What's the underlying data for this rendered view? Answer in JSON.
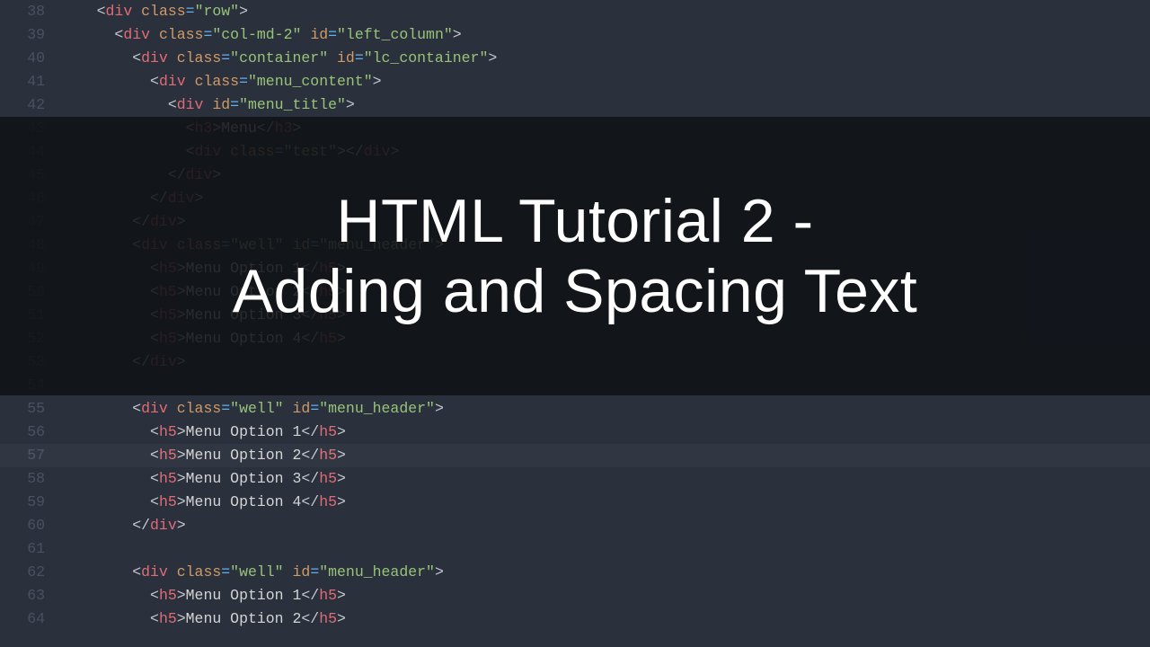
{
  "overlay": {
    "line1": "HTML Tutorial 2 -",
    "line2": "Adding and Spacing Text"
  },
  "highlight_line": 57,
  "first_line_number": 38,
  "code_lines": [
    {
      "n": 38,
      "ind": 2,
      "t": [
        [
          "p",
          "<"
        ],
        [
          "tg",
          "div"
        ],
        [
          "p",
          " "
        ],
        [
          "an",
          "class"
        ],
        [
          "op",
          "="
        ],
        [
          "st",
          "\"row\""
        ],
        [
          "p",
          ">"
        ]
      ]
    },
    {
      "n": 39,
      "ind": 3,
      "t": [
        [
          "p",
          "<"
        ],
        [
          "tg",
          "div"
        ],
        [
          "p",
          " "
        ],
        [
          "an",
          "class"
        ],
        [
          "op",
          "="
        ],
        [
          "st",
          "\"col-md-2\""
        ],
        [
          "p",
          " "
        ],
        [
          "an",
          "id"
        ],
        [
          "op",
          "="
        ],
        [
          "st",
          "\"left_column\""
        ],
        [
          "p",
          ">"
        ]
      ]
    },
    {
      "n": 40,
      "ind": 4,
      "t": [
        [
          "p",
          "<"
        ],
        [
          "tg",
          "div"
        ],
        [
          "p",
          " "
        ],
        [
          "an",
          "class"
        ],
        [
          "op",
          "="
        ],
        [
          "st",
          "\"container\""
        ],
        [
          "p",
          " "
        ],
        [
          "an",
          "id"
        ],
        [
          "op",
          "="
        ],
        [
          "st",
          "\"lc_container\""
        ],
        [
          "p",
          ">"
        ]
      ]
    },
    {
      "n": 41,
      "ind": 5,
      "t": [
        [
          "p",
          "<"
        ],
        [
          "tg",
          "div"
        ],
        [
          "p",
          " "
        ],
        [
          "an",
          "class"
        ],
        [
          "op",
          "="
        ],
        [
          "st",
          "\"menu_content\""
        ],
        [
          "p",
          ">"
        ]
      ]
    },
    {
      "n": 42,
      "ind": 6,
      "t": [
        [
          "p",
          "<"
        ],
        [
          "tg",
          "div"
        ],
        [
          "p",
          " "
        ],
        [
          "an",
          "id"
        ],
        [
          "op",
          "="
        ],
        [
          "st",
          "\"menu_title\""
        ],
        [
          "p",
          ">"
        ]
      ]
    },
    {
      "n": 43,
      "ind": 7,
      "t": [
        [
          "p",
          "<"
        ],
        [
          "tg",
          "h3"
        ],
        [
          "p",
          ">"
        ],
        [
          "tx",
          "Menu"
        ],
        [
          "p",
          "</"
        ],
        [
          "tg",
          "h3"
        ],
        [
          "p",
          ">"
        ]
      ]
    },
    {
      "n": 44,
      "ind": 7,
      "t": [
        [
          "p",
          "<"
        ],
        [
          "tg",
          "div"
        ],
        [
          "p",
          " "
        ],
        [
          "an",
          "class"
        ],
        [
          "op",
          "="
        ],
        [
          "st",
          "\"test\""
        ],
        [
          "p",
          "></"
        ],
        [
          "tg",
          "div"
        ],
        [
          "p",
          ">"
        ]
      ]
    },
    {
      "n": 45,
      "ind": 6,
      "t": [
        [
          "p",
          "</"
        ],
        [
          "tg",
          "div"
        ],
        [
          "p",
          ">"
        ]
      ]
    },
    {
      "n": 46,
      "ind": 5,
      "t": [
        [
          "p",
          "</"
        ],
        [
          "tg",
          "div"
        ],
        [
          "p",
          ">"
        ]
      ]
    },
    {
      "n": 47,
      "ind": 4,
      "t": [
        [
          "p",
          "</"
        ],
        [
          "tg",
          "div"
        ],
        [
          "p",
          ">"
        ]
      ]
    },
    {
      "n": 48,
      "ind": 4,
      "t": [
        [
          "p",
          "<"
        ],
        [
          "tg",
          "div"
        ],
        [
          "p",
          " "
        ],
        [
          "an",
          "class"
        ],
        [
          "op",
          "="
        ],
        [
          "st",
          "\"well\""
        ],
        [
          "p",
          " "
        ],
        [
          "an",
          "id"
        ],
        [
          "op",
          "="
        ],
        [
          "st",
          "\"menu_header\""
        ],
        [
          "p",
          ">"
        ]
      ]
    },
    {
      "n": 49,
      "ind": 5,
      "t": [
        [
          "p",
          "<"
        ],
        [
          "tg",
          "h5"
        ],
        [
          "p",
          ">"
        ],
        [
          "tx",
          "Menu Option 1"
        ],
        [
          "p",
          "</"
        ],
        [
          "tg",
          "h5"
        ],
        [
          "p",
          ">"
        ]
      ]
    },
    {
      "n": 50,
      "ind": 5,
      "t": [
        [
          "p",
          "<"
        ],
        [
          "tg",
          "h5"
        ],
        [
          "p",
          ">"
        ],
        [
          "tx",
          "Menu Option 2"
        ],
        [
          "p",
          "</"
        ],
        [
          "tg",
          "h5"
        ],
        [
          "p",
          ">"
        ]
      ]
    },
    {
      "n": 51,
      "ind": 5,
      "t": [
        [
          "p",
          "<"
        ],
        [
          "tg",
          "h5"
        ],
        [
          "p",
          ">"
        ],
        [
          "tx",
          "Menu Option 3"
        ],
        [
          "p",
          "</"
        ],
        [
          "tg",
          "h5"
        ],
        [
          "p",
          ">"
        ]
      ]
    },
    {
      "n": 52,
      "ind": 5,
      "t": [
        [
          "p",
          "<"
        ],
        [
          "tg",
          "h5"
        ],
        [
          "p",
          ">"
        ],
        [
          "tx",
          "Menu Option 4"
        ],
        [
          "p",
          "</"
        ],
        [
          "tg",
          "h5"
        ],
        [
          "p",
          ">"
        ]
      ]
    },
    {
      "n": 53,
      "ind": 4,
      "t": [
        [
          "p",
          "</"
        ],
        [
          "tg",
          "div"
        ],
        [
          "p",
          ">"
        ]
      ]
    },
    {
      "n": 54,
      "ind": 0,
      "t": []
    },
    {
      "n": 55,
      "ind": 4,
      "t": [
        [
          "p",
          "<"
        ],
        [
          "tg",
          "div"
        ],
        [
          "p",
          " "
        ],
        [
          "an",
          "class"
        ],
        [
          "op",
          "="
        ],
        [
          "st",
          "\"well\""
        ],
        [
          "p",
          " "
        ],
        [
          "an",
          "id"
        ],
        [
          "op",
          "="
        ],
        [
          "st",
          "\"menu_header\""
        ],
        [
          "p",
          ">"
        ]
      ]
    },
    {
      "n": 56,
      "ind": 5,
      "t": [
        [
          "p",
          "<"
        ],
        [
          "tg",
          "h5"
        ],
        [
          "p",
          ">"
        ],
        [
          "tx",
          "Menu Option 1"
        ],
        [
          "p",
          "</"
        ],
        [
          "tg",
          "h5"
        ],
        [
          "p",
          ">"
        ]
      ]
    },
    {
      "n": 57,
      "ind": 5,
      "t": [
        [
          "p",
          "<"
        ],
        [
          "tg",
          "h5"
        ],
        [
          "p",
          ">"
        ],
        [
          "tx",
          "Menu Option 2"
        ],
        [
          "p",
          "</"
        ],
        [
          "tg",
          "h5"
        ],
        [
          "p",
          ">"
        ]
      ]
    },
    {
      "n": 58,
      "ind": 5,
      "t": [
        [
          "p",
          "<"
        ],
        [
          "tg",
          "h5"
        ],
        [
          "p",
          ">"
        ],
        [
          "tx",
          "Menu Option 3"
        ],
        [
          "p",
          "</"
        ],
        [
          "tg",
          "h5"
        ],
        [
          "p",
          ">"
        ]
      ]
    },
    {
      "n": 59,
      "ind": 5,
      "t": [
        [
          "p",
          "<"
        ],
        [
          "tg",
          "h5"
        ],
        [
          "p",
          ">"
        ],
        [
          "tx",
          "Menu Option 4"
        ],
        [
          "p",
          "</"
        ],
        [
          "tg",
          "h5"
        ],
        [
          "p",
          ">"
        ]
      ]
    },
    {
      "n": 60,
      "ind": 4,
      "t": [
        [
          "p",
          "</"
        ],
        [
          "tg",
          "div"
        ],
        [
          "p",
          ">"
        ]
      ]
    },
    {
      "n": 61,
      "ind": 0,
      "t": []
    },
    {
      "n": 62,
      "ind": 4,
      "t": [
        [
          "p",
          "<"
        ],
        [
          "tg",
          "div"
        ],
        [
          "p",
          " "
        ],
        [
          "an",
          "class"
        ],
        [
          "op",
          "="
        ],
        [
          "st",
          "\"well\""
        ],
        [
          "p",
          " "
        ],
        [
          "an",
          "id"
        ],
        [
          "op",
          "="
        ],
        [
          "st",
          "\"menu_header\""
        ],
        [
          "p",
          ">"
        ]
      ]
    },
    {
      "n": 63,
      "ind": 5,
      "t": [
        [
          "p",
          "<"
        ],
        [
          "tg",
          "h5"
        ],
        [
          "p",
          ">"
        ],
        [
          "tx",
          "Menu Option 1"
        ],
        [
          "p",
          "</"
        ],
        [
          "tg",
          "h5"
        ],
        [
          "p",
          ">"
        ]
      ]
    },
    {
      "n": 64,
      "ind": 5,
      "t": [
        [
          "p",
          "<"
        ],
        [
          "tg",
          "h5"
        ],
        [
          "p",
          ">"
        ],
        [
          "tx",
          "Menu Option 2"
        ],
        [
          "p",
          "</"
        ],
        [
          "tg",
          "h5"
        ],
        [
          "p",
          ">"
        ]
      ]
    }
  ]
}
